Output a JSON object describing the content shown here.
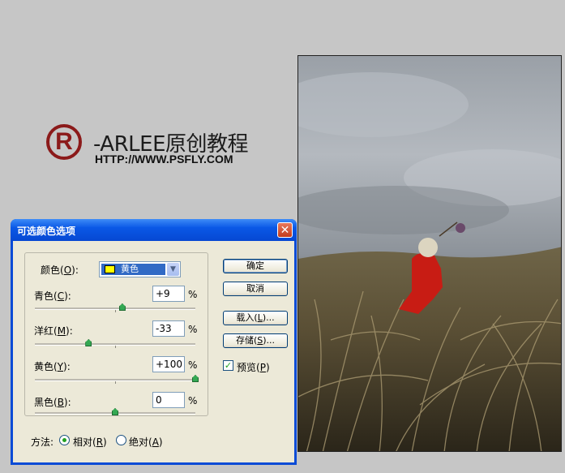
{
  "watermark": {
    "logo_letter": "R",
    "title": "-ARLEE原创教程",
    "url": "HTTP://WWW.PSFLY.COM"
  },
  "dialog": {
    "title": "可选颜色选项",
    "close_glyph": "✕",
    "colors_label": "颜色(",
    "colors_key": "O",
    "colors_label_end": "):",
    "colors_value": "黄色",
    "swatch_color": "#ffff00",
    "sliders": [
      {
        "label": "青色(",
        "key": "C",
        "label_end": "):",
        "value": "+9",
        "unit": "%",
        "percent": 9
      },
      {
        "label": "洋红(",
        "key": "M",
        "label_end": "):",
        "value": "-33",
        "unit": "%",
        "percent": -33
      },
      {
        "label": "黄色(",
        "key": "Y",
        "label_end": "):",
        "value": "+100",
        "unit": "%",
        "percent": 100
      },
      {
        "label": "黑色(",
        "key": "B",
        "label_end": "):",
        "value": "0",
        "unit": "%",
        "percent": 0
      }
    ],
    "buttons": {
      "ok": "确定",
      "cancel": "取消",
      "load": "载入(",
      "load_key": "L",
      "load_end": ")...",
      "save": "存储(",
      "save_key": "S",
      "save_end": ")..."
    },
    "preview": {
      "label": "预览(",
      "key": "P",
      "label_end": ")",
      "checked": true
    },
    "method": {
      "label": "方法:",
      "relative": "相对(",
      "relative_key": "R",
      "relative_end": ")",
      "absolute": "绝对(",
      "absolute_key": "A",
      "absolute_end": ")",
      "selected": "relative"
    }
  }
}
